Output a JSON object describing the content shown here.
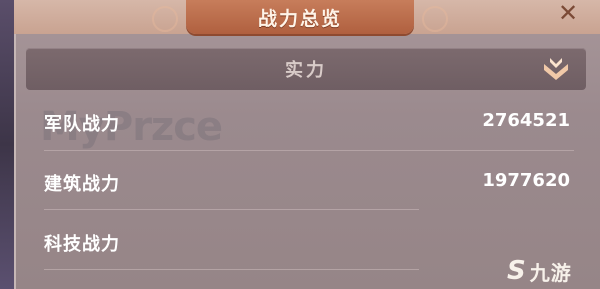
{
  "header": {
    "title": "战力总览",
    "close_label": "✕"
  },
  "section": {
    "title": "实力",
    "toggle_icon": "collapse-chevron-icon"
  },
  "stats": [
    {
      "label": "军队战力",
      "value": "2764521"
    },
    {
      "label": "建筑战力",
      "value": "1977620"
    },
    {
      "label": "科技战力",
      "value": ""
    }
  ],
  "watermark": "MyPrzce",
  "logo": {
    "mark": "S",
    "text": "九游"
  },
  "colors": {
    "panel": "#9b8a8e",
    "title_plaque": "#b0603f",
    "section_bar": "#6f5e63",
    "text": "#ffffff"
  }
}
